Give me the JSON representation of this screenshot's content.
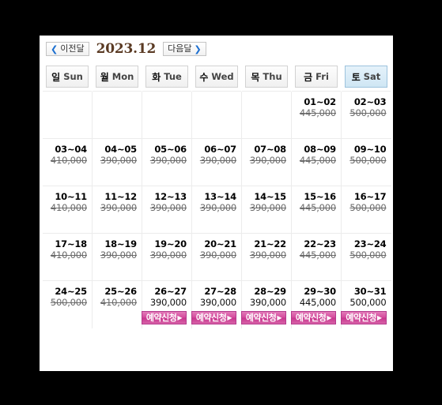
{
  "nav": {
    "prev_label": "이전달",
    "next_label": "다음달",
    "prev_chevron": "❮",
    "next_chevron": "❯",
    "month_title": "2023.12"
  },
  "weekdays": [
    {
      "ko": "일",
      "en": "Sun",
      "highlight": false
    },
    {
      "ko": "월",
      "en": "Mon",
      "highlight": false
    },
    {
      "ko": "화",
      "en": "Tue",
      "highlight": false
    },
    {
      "ko": "수",
      "en": "Wed",
      "highlight": false
    },
    {
      "ko": "목",
      "en": "Thu",
      "highlight": false
    },
    {
      "ko": "금",
      "en": "Fri",
      "highlight": false
    },
    {
      "ko": "토",
      "en": "Sat",
      "highlight": true
    }
  ],
  "book_button": {
    "label": "예약신청",
    "arrow": "▶",
    "color": "#d0479a"
  },
  "weeks": [
    [
      {
        "empty": true
      },
      {
        "empty": true
      },
      {
        "empty": true
      },
      {
        "empty": true
      },
      {
        "empty": true
      },
      {
        "date": "01~02",
        "price": "445,000",
        "sold": true,
        "book": false
      },
      {
        "date": "02~03",
        "price": "500,000",
        "sold": true,
        "book": false
      }
    ],
    [
      {
        "date": "03~04",
        "price": "410,000",
        "sold": true,
        "book": false
      },
      {
        "date": "04~05",
        "price": "390,000",
        "sold": true,
        "book": false
      },
      {
        "date": "05~06",
        "price": "390,000",
        "sold": true,
        "book": false
      },
      {
        "date": "06~07",
        "price": "390,000",
        "sold": true,
        "book": false
      },
      {
        "date": "07~08",
        "price": "390,000",
        "sold": true,
        "book": false
      },
      {
        "date": "08~09",
        "price": "445,000",
        "sold": true,
        "book": false
      },
      {
        "date": "09~10",
        "price": "500,000",
        "sold": true,
        "book": false
      }
    ],
    [
      {
        "date": "10~11",
        "price": "410,000",
        "sold": true,
        "book": false
      },
      {
        "date": "11~12",
        "price": "390,000",
        "sold": true,
        "book": false
      },
      {
        "date": "12~13",
        "price": "390,000",
        "sold": true,
        "book": false
      },
      {
        "date": "13~14",
        "price": "390,000",
        "sold": true,
        "book": false
      },
      {
        "date": "14~15",
        "price": "390,000",
        "sold": true,
        "book": false
      },
      {
        "date": "15~16",
        "price": "445,000",
        "sold": true,
        "book": false
      },
      {
        "date": "16~17",
        "price": "500,000",
        "sold": true,
        "book": false
      }
    ],
    [
      {
        "date": "17~18",
        "price": "410,000",
        "sold": true,
        "book": false
      },
      {
        "date": "18~19",
        "price": "390,000",
        "sold": true,
        "book": false
      },
      {
        "date": "19~20",
        "price": "390,000",
        "sold": true,
        "book": false
      },
      {
        "date": "20~21",
        "price": "390,000",
        "sold": true,
        "book": false
      },
      {
        "date": "21~22",
        "price": "390,000",
        "sold": true,
        "book": false
      },
      {
        "date": "22~23",
        "price": "445,000",
        "sold": true,
        "book": false
      },
      {
        "date": "23~24",
        "price": "500,000",
        "sold": true,
        "book": false
      }
    ],
    [
      {
        "date": "24~25",
        "price": "500,000",
        "sold": true,
        "book": false
      },
      {
        "date": "25~26",
        "price": "410,000",
        "sold": true,
        "book": false
      },
      {
        "date": "26~27",
        "price": "390,000",
        "sold": false,
        "book": true
      },
      {
        "date": "27~28",
        "price": "390,000",
        "sold": false,
        "book": true
      },
      {
        "date": "28~29",
        "price": "390,000",
        "sold": false,
        "book": true
      },
      {
        "date": "29~30",
        "price": "445,000",
        "sold": false,
        "book": true
      },
      {
        "date": "30~31",
        "price": "500,000",
        "sold": false,
        "book": true
      }
    ]
  ]
}
